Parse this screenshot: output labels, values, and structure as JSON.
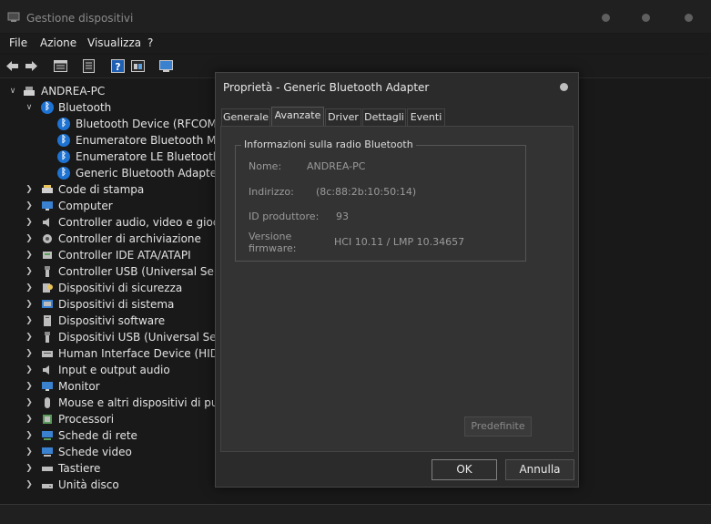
{
  "window": {
    "title": "Gestione dispositivi"
  },
  "menu": {
    "file": "File",
    "azione": "Azione",
    "visualizza": "Visualizza",
    "help": "?"
  },
  "tree": {
    "root": "ANDREA-PC",
    "bluetooth": {
      "label": "Bluetooth",
      "children": [
        "Bluetooth Device (RFCOMM",
        "Enumeratore Bluetooth Micro",
        "Enumeratore LE Bluetooth M",
        "Generic Bluetooth Adapter"
      ]
    },
    "categories": [
      "Code di stampa",
      "Computer",
      "Controller audio, video e giochi",
      "Controller di archiviazione",
      "Controller IDE ATA/ATAPI",
      "Controller USB (Universal Serial B",
      "Dispositivi di sicurezza",
      "Dispositivi di sistema",
      "Dispositivi software",
      "Dispositivi USB (Universal Serial B",
      "Human Interface Device (HID)",
      "Input e output audio",
      "Monitor",
      "Mouse e altri dispositivi di punta",
      "Processori",
      "Schede di rete",
      "Schede video",
      "Tastiere",
      "Unità disco"
    ]
  },
  "dialog": {
    "title": "Proprietà - Generic Bluetooth Adapter",
    "tabs": [
      "Generale",
      "Avanzate",
      "Driver",
      "Dettagli",
      "Eventi"
    ],
    "active_tab": "Avanzate",
    "group_title": "Informazioni sulla radio Bluetooth",
    "fields": {
      "nome_label": "Nome:",
      "nome_value": "ANDREA-PC",
      "indirizzo_label": "Indirizzo:",
      "indirizzo_value": "(8c:88:2b:10:50:14)",
      "produttore_label": "ID produttore:",
      "produttore_value": "93",
      "firmware_label_1": "Versione",
      "firmware_label_2": "firmware:",
      "firmware_value": "HCI 10.11  /  LMP 10.34657"
    },
    "predefinite": "Predefinite",
    "ok": "OK",
    "annulla": "Annulla"
  },
  "colors": {
    "bluetooth_icon": "#1e73d2",
    "background": "#191919",
    "dialog": "#2b2b2b"
  }
}
